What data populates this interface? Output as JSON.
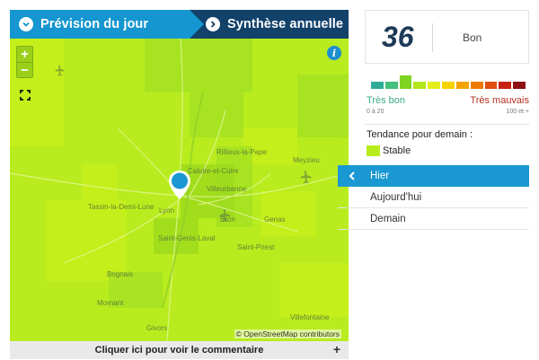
{
  "tabs": [
    {
      "label": "Prévision du jour",
      "active": true
    },
    {
      "label": "Synthèse annuelle",
      "active": false
    }
  ],
  "map": {
    "zoom_in": "+",
    "zoom_out": "−",
    "info": "i",
    "attribution": "© OpenStreetMap contributors",
    "places": [
      "Rillieux-la-Pape",
      "Caluire-et-Cuire",
      "Meyzieu",
      "Villeurbanne",
      "Tassin-la-Demi-Lune",
      "Lyon",
      "Bron",
      "Genas",
      "Saint-Genis-Laval",
      "Saint-Priest",
      "Brignais",
      "Mornant",
      "Givors",
      "Villefontaine"
    ]
  },
  "comment": {
    "label": "Cliquer ici pour voir le commentaire",
    "plus": "+"
  },
  "index": {
    "value": "36",
    "label": "Bon"
  },
  "scale": {
    "colors": [
      "#2eab96",
      "#43c07a",
      "#7ed321",
      "#b3e61c",
      "#e3ee1a",
      "#f5d300",
      "#f4a400",
      "#ee7a00",
      "#e04e10",
      "#c8200e",
      "#8e1010"
    ],
    "active_index": 2,
    "left_label": "Très bon",
    "right_label": "Très mauvais",
    "left_sub": "0 à 20",
    "right_sub": "100 et +"
  },
  "trend": {
    "title": "Tendance pour demain :",
    "label": "Stable",
    "color": "#b8ec1e"
  },
  "days": [
    {
      "label": "Hier",
      "active": true
    },
    {
      "label": "Aujourd'hui",
      "active": false
    },
    {
      "label": "Demain",
      "active": false
    }
  ]
}
